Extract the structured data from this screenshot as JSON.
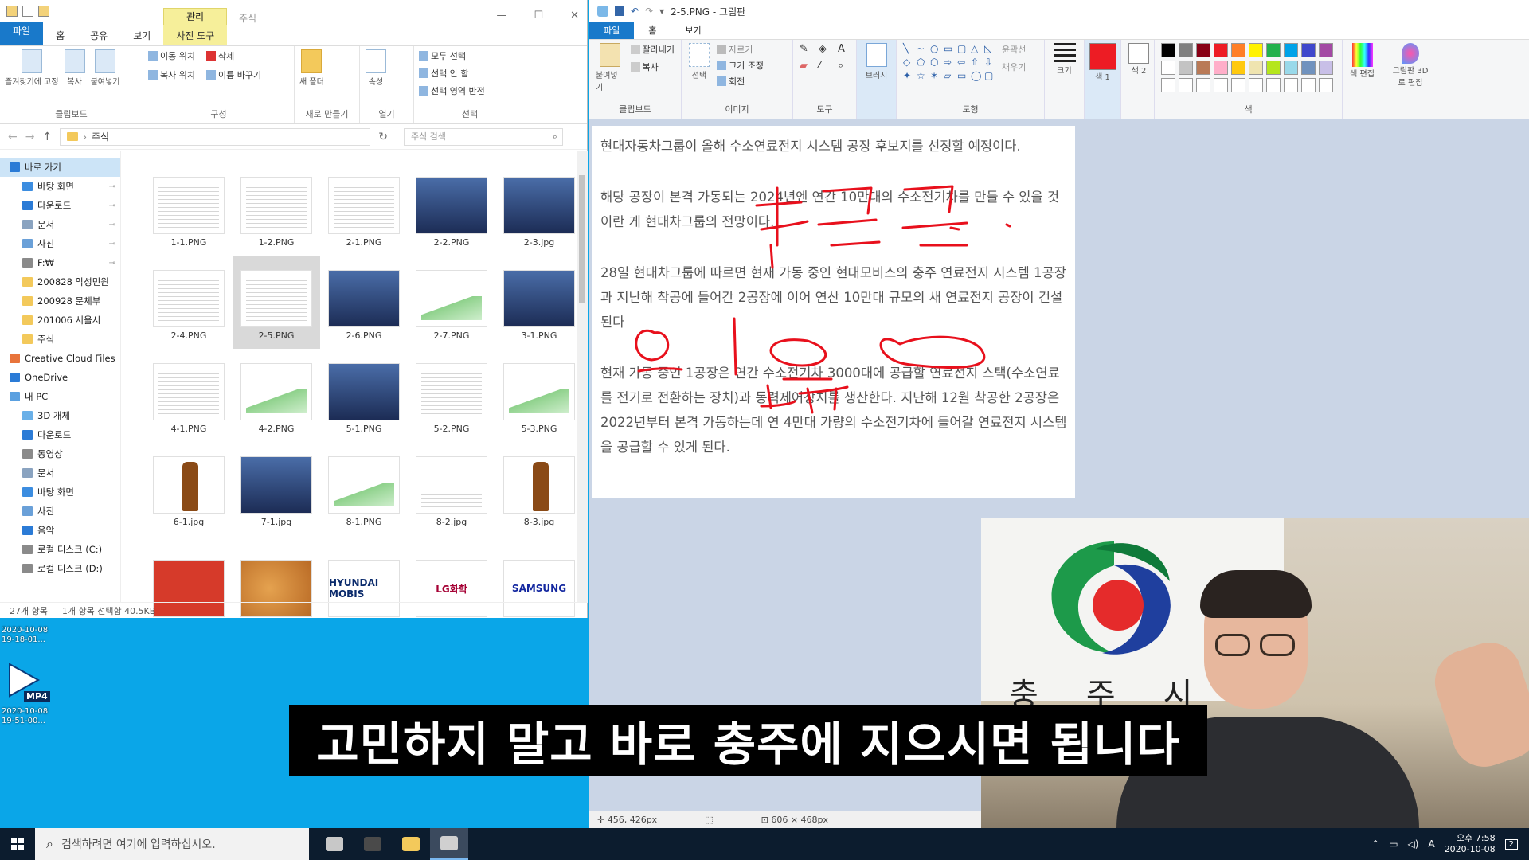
{
  "explorer": {
    "tool_tab": "관리",
    "title": "주식",
    "tabs": [
      "파일",
      "홈",
      "공유",
      "보기",
      "사진 도구"
    ],
    "ribbon": {
      "clipboard": {
        "items": [
          "즐겨찾기에 고정",
          "복사",
          "붙여넣기"
        ],
        "label": "클립보드"
      },
      "organize": {
        "items": [
          "이동 위치",
          "삭제",
          "복사 위치",
          "이름 바꾸기"
        ],
        "label": "구성"
      },
      "new": {
        "items": [
          "새 폴더"
        ],
        "label": "새로 만들기"
      },
      "open": {
        "items": [
          "속성"
        ],
        "label": "열기"
      },
      "select": {
        "items": [
          "모두 선택",
          "선택 안 함",
          "선택 영역 반전"
        ],
        "label": "선택"
      }
    },
    "address": "주식",
    "search_placeholder": "주식 검색",
    "nav": [
      {
        "label": "바로 가기",
        "icon": "star-icon",
        "color": "#2b7bd6",
        "selected": true,
        "pin": false
      },
      {
        "label": "바탕 화면",
        "icon": "desktop-icon",
        "color": "#3c8de0",
        "pin": true
      },
      {
        "label": "다운로드",
        "icon": "download-icon",
        "color": "#2b7bd6",
        "pin": true
      },
      {
        "label": "문서",
        "icon": "document-icon",
        "color": "#8aa3c0",
        "pin": true
      },
      {
        "label": "사진",
        "icon": "picture-icon",
        "color": "#6aa0d8",
        "pin": true
      },
      {
        "label": "F:₩",
        "icon": "drive-icon",
        "color": "#8a8a8a",
        "pin": true
      },
      {
        "label": "200828 악성민원",
        "icon": "folder-icon",
        "color": "#f3c95b",
        "pin": false
      },
      {
        "label": "200928 문체부",
        "icon": "folder-icon",
        "color": "#f3c95b",
        "pin": false
      },
      {
        "label": "201006 서울시",
        "icon": "folder-icon",
        "color": "#f3c95b",
        "pin": false
      },
      {
        "label": "주식",
        "icon": "folder-icon",
        "color": "#f3c95b",
        "pin": false
      },
      {
        "label": "Creative Cloud Files",
        "icon": "creative-cloud-icon",
        "color": "#e8743b",
        "pin": false
      },
      {
        "label": "OneDrive",
        "icon": "onedrive-icon",
        "color": "#2b7bd6",
        "pin": false
      },
      {
        "label": "내 PC",
        "icon": "pc-icon",
        "color": "#5aa0e0",
        "pin": false
      },
      {
        "label": "3D 개체",
        "icon": "cube-icon",
        "color": "#6ab0e8",
        "pin": false
      },
      {
        "label": "다운로드",
        "icon": "download-icon",
        "color": "#2b7bd6",
        "pin": false
      },
      {
        "label": "동영상",
        "icon": "video-icon",
        "color": "#8a8a8a",
        "pin": false
      },
      {
        "label": "문서",
        "icon": "document-icon",
        "color": "#8aa3c0",
        "pin": false
      },
      {
        "label": "바탕 화면",
        "icon": "desktop-icon",
        "color": "#3c8de0",
        "pin": false
      },
      {
        "label": "사진",
        "icon": "picture-icon",
        "color": "#6aa0d8",
        "pin": false
      },
      {
        "label": "음악",
        "icon": "music-icon",
        "color": "#2b7bd6",
        "pin": false
      },
      {
        "label": "로컬 디스크 (C:)",
        "icon": "disk-icon",
        "color": "#8a8a8a",
        "pin": false
      },
      {
        "label": "로컬 디스크 (D:)",
        "icon": "disk-icon",
        "color": "#8a8a8a",
        "pin": false
      }
    ],
    "files": [
      {
        "name": "1-1.PNG",
        "thumb": "doc",
        "label": "",
        "selected": false
      },
      {
        "name": "1-2.PNG",
        "thumb": "doc",
        "label": "",
        "selected": false
      },
      {
        "name": "2-1.PNG",
        "thumb": "doc",
        "label": "",
        "selected": false
      },
      {
        "name": "2-2.PNG",
        "thumb": "photo",
        "label": "",
        "selected": false
      },
      {
        "name": "2-3.jpg",
        "thumb": "photo",
        "label": "",
        "selected": false
      },
      {
        "name": "2-4.PNG",
        "thumb": "doc",
        "label": "",
        "selected": false
      },
      {
        "name": "2-5.PNG",
        "thumb": "doc",
        "label": "",
        "selected": true
      },
      {
        "name": "2-6.PNG",
        "thumb": "photo",
        "label": "",
        "selected": false
      },
      {
        "name": "2-7.PNG",
        "thumb": "chart",
        "label": "",
        "selected": false
      },
      {
        "name": "3-1.PNG",
        "thumb": "photo",
        "label": "",
        "selected": false
      },
      {
        "name": "4-1.PNG",
        "thumb": "doc",
        "label": "",
        "selected": false
      },
      {
        "name": "4-2.PNG",
        "thumb": "chart",
        "label": "",
        "selected": false
      },
      {
        "name": "5-1.PNG",
        "thumb": "photo",
        "label": "",
        "selected": false
      },
      {
        "name": "5-2.PNG",
        "thumb": "doc",
        "label": "",
        "selected": false
      },
      {
        "name": "5-3.PNG",
        "thumb": "chart",
        "label": "",
        "selected": false
      },
      {
        "name": "6-1.jpg",
        "thumb": "bottle",
        "label": "",
        "selected": false
      },
      {
        "name": "7-1.jpg",
        "thumb": "photo",
        "label": "",
        "selected": false
      },
      {
        "name": "8-1.PNG",
        "thumb": "chart",
        "label": "",
        "selected": false
      },
      {
        "name": "8-2.jpg",
        "thumb": "doc",
        "label": "",
        "selected": false
      },
      {
        "name": "8-3.jpg",
        "thumb": "bottle",
        "label": "",
        "selected": false
      },
      {
        "name": "",
        "thumb": "snack",
        "label": "",
        "selected": false
      },
      {
        "name": "",
        "thumb": "food",
        "label": "",
        "selected": false
      },
      {
        "name": "",
        "thumb": "logo",
        "label": "HYUNDAI MOBIS",
        "color": "#0a2a6b",
        "selected": false
      },
      {
        "name": "",
        "thumb": "logo",
        "label": "LG화학",
        "color": "#a50034",
        "selected": false
      },
      {
        "name": "",
        "thumb": "logo",
        "label": "SAMSUNG",
        "color": "#1428a0",
        "selected": false
      }
    ],
    "status": {
      "count": "27개 항목",
      "selection": "1개 항목 선택함 40.5KB"
    }
  },
  "desktop": {
    "item1_date": "2020-10-08",
    "item1_time": "19-18-01...",
    "mp4_label": "MP4",
    "item2_date": "2020-10-08",
    "item2_time": "19-51-00..."
  },
  "paint": {
    "title": "2-5.PNG - 그림판",
    "tabs": [
      "파일",
      "홈",
      "보기"
    ],
    "ribbon": {
      "clipboard": {
        "items": [
          "잘라내기",
          "복사",
          "붙여넣기"
        ],
        "label": "클립보드"
      },
      "image": {
        "items": [
          "선택",
          "자르기",
          "크기 조정",
          "회전"
        ],
        "label": "이미지"
      },
      "tools": {
        "label": "도구"
      },
      "brush": "브러시",
      "shapes": {
        "items": [
          "윤곽선",
          "채우기"
        ],
        "label": "도형"
      },
      "size": "크기",
      "color1": "색 1",
      "color2": "색 2",
      "edit_colors": "색 편집",
      "paint3d": "그림판 3D로 편집",
      "colors_label": "색"
    },
    "palette": [
      "#000000",
      "#7f7f7f",
      "#880015",
      "#ed1c24",
      "#ff7f27",
      "#fff200",
      "#22b14c",
      "#00a2e8",
      "#3f48cc",
      "#a349a4",
      "#ffffff",
      "#c3c3c3",
      "#b97a57",
      "#ffaec9",
      "#ffc90e",
      "#efe4b0",
      "#b5e61d",
      "#99d9ea",
      "#7092be",
      "#c8bfe7",
      "#ffffff",
      "#ffffff",
      "#ffffff",
      "#ffffff",
      "#ffffff",
      "#ffffff",
      "#ffffff",
      "#ffffff",
      "#ffffff",
      "#ffffff"
    ],
    "color1": "#ed1c24",
    "paragraphs": [
      "현대자동차그룹이 올해 수소연료전지 시스템 공장 후보지를 선정할 예정이다.",
      "해당 공장이 본격 가동되는 2024년엔 연간 10만대의 수소전기차를 만들 수 있을 것이란 게 현대차그룹의 전망이다.",
      "28일 현대차그룹에 따르면 현재 가동 중인 현대모비스의 충주 연료전지 시스템 1공장과 지난해 착공에 들어간 2공장에 이어 연산 10만대 규모의 새 연료전지 공장이 건설된다",
      "현재 가동 중인 1공장은 연간 수소전기차 3000대에 공급할 연료전지 스택(수소연료를 전기로 전환하는 장치)과 동력제어장치를 생산한다. 지난해 12월 착공한 2공장은 2022년부터 본격 가동하는데 연 4만대 가량의 수소전기차에 들어갈 연료전지 시스템을 공급할 수 있게 된다."
    ],
    "status_cursor": "456, 426px",
    "status_size": "606 × 468px"
  },
  "webcam": {
    "sign_chars": [
      "충",
      "주",
      "시"
    ]
  },
  "subtitle": "고민하지 말고 바로 충주에 지으시면 됩니다",
  "taskbar": {
    "search_placeholder": "검색하려면 여기에 입력하십시오.",
    "apps": [
      {
        "icon": "paint-app-icon",
        "color": "#c8c8c8",
        "active": false
      },
      {
        "icon": "obs-icon",
        "color": "#4a4a4a",
        "active": false
      },
      {
        "icon": "file-explorer-icon",
        "color": "#f3c95b",
        "active": false
      },
      {
        "icon": "paint-active-icon",
        "color": "#d0d0d0",
        "active": true
      }
    ],
    "ime": "A",
    "time": "오후 7:58",
    "date": "2020-10-08",
    "notification_count": "2"
  }
}
